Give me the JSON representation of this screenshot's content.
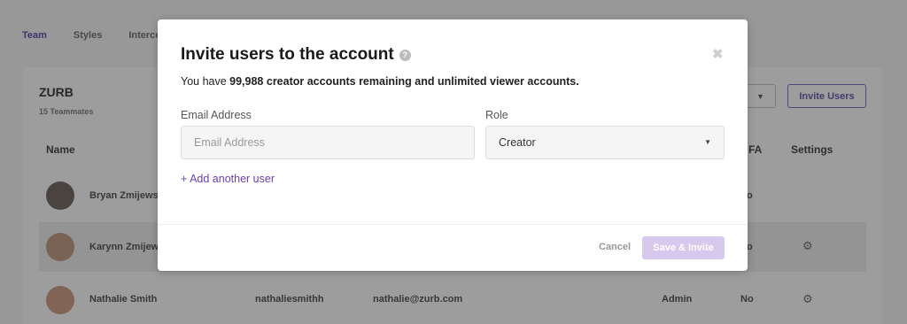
{
  "background": {
    "tabs": [
      "Team",
      "Styles",
      "Interce"
    ],
    "team_name": "ZURB",
    "team_count": "15 Teammates",
    "invite_button": "Invite Users",
    "filter_caret": "▼",
    "columns": {
      "name": "Name",
      "fa": "FA",
      "settings": "Settings"
    },
    "rows": [
      {
        "name": "Bryan Zmijewsk",
        "username": "",
        "email": "",
        "role": "",
        "twofa": "o"
      },
      {
        "name": "Karynn Zmijew",
        "username": "",
        "email": "",
        "role": "",
        "twofa": "o"
      },
      {
        "name": "Nathalie Smith",
        "username": "nathaliesmithh",
        "email": "nathalie@zurb.com",
        "role": "Admin",
        "twofa": "No"
      }
    ]
  },
  "modal": {
    "title": "Invite users to the account",
    "info_prefix": "You have ",
    "info_bold": "99,988 creator accounts remaining and unlimited viewer accounts.",
    "email_label": "Email Address",
    "email_placeholder": "Email Address",
    "role_label": "Role",
    "role_value": "Creator",
    "add_user_link": "+ Add another user",
    "cancel_label": "Cancel",
    "save_label": "Save & Invite",
    "close_glyph": "✖",
    "help_glyph": "?"
  },
  "colors": {
    "accent": "#6b3fb5",
    "save_disabled": "#d7c9ee",
    "overlay": "rgba(60,60,60,0.5)"
  }
}
